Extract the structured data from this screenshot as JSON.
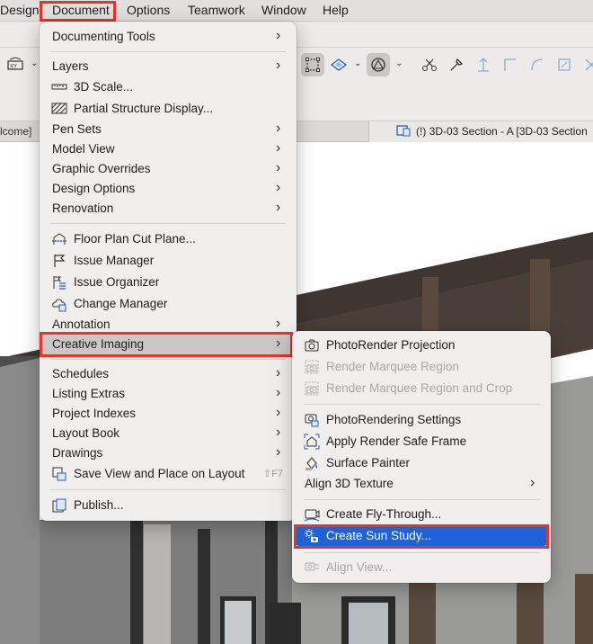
{
  "menubar": {
    "items": [
      "Design",
      "Document",
      "Options",
      "Teamwork",
      "Window",
      "Help"
    ]
  },
  "tabs": {
    "left_label": "lcome]",
    "right_label": "(!) 3D-03 Section - A [3D-03 Section"
  },
  "document_menu": {
    "documenting_tools": "Documenting Tools",
    "layers": "Layers",
    "scale_3d": "3D Scale...",
    "partial_structure": "Partial Structure Display...",
    "pen_sets": "Pen Sets",
    "model_view": "Model View",
    "graphic_overrides": "Graphic Overrides",
    "design_options": "Design Options",
    "renovation": "Renovation",
    "floor_plan_cut": "Floor Plan Cut Plane...",
    "issue_manager": "Issue Manager",
    "issue_organizer": "Issue Organizer",
    "change_manager": "Change Manager",
    "annotation": "Annotation",
    "creative_imaging": "Creative Imaging",
    "schedules": "Schedules",
    "listing_extras": "Listing Extras",
    "project_indexes": "Project Indexes",
    "layout_book": "Layout Book",
    "drawings": "Drawings",
    "save_view": "Save View and Place on Layout",
    "save_view_shortcut": "⇧F7",
    "publish": "Publish..."
  },
  "creative_imaging_menu": {
    "photorender_projection": "PhotoRender Projection",
    "render_marquee_region": "Render Marquee Region",
    "render_marquee_crop": "Render Marquee Region and Crop",
    "photorendering_settings": "PhotoRendering Settings",
    "apply_render_safe_frame": "Apply Render Safe Frame",
    "surface_painter": "Surface Painter",
    "align_3d_texture": "Align 3D Texture",
    "create_fly_through": "Create Fly-Through...",
    "create_sun_study": "Create Sun Study...",
    "align_view": "Align View..."
  },
  "colors": {
    "highlight_red": "#e6352b",
    "selection_blue": "#1d62d6"
  }
}
